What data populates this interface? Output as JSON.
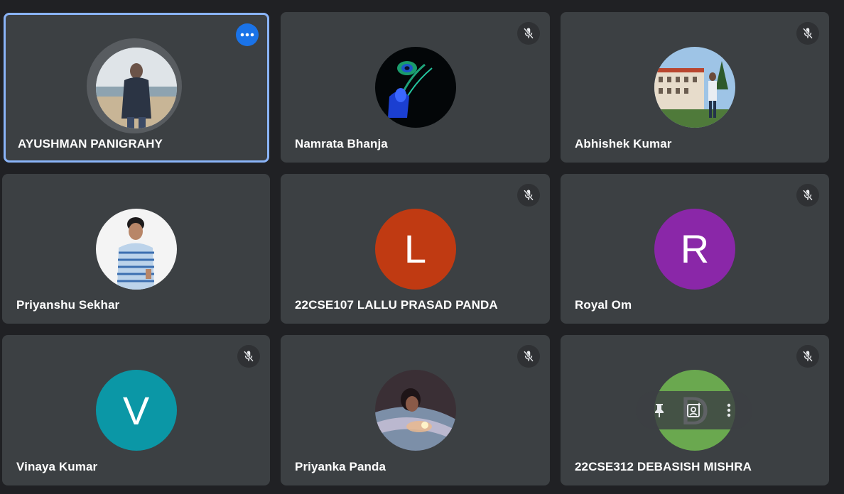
{
  "participants": [
    {
      "name": "AYUSHMAN PANIGRAHY",
      "avatar": "photo-beach-person-icon",
      "muted": false,
      "speaking": true
    },
    {
      "name": "Namrata Bhanja",
      "avatar": "photo-peacock-feather-icon",
      "muted": true
    },
    {
      "name": "Abhishek Kumar",
      "avatar": "photo-building-person-icon",
      "muted": true
    },
    {
      "name": "Priyanshu Sekhar",
      "avatar": "photo-person-striped-shirt-icon",
      "muted": false
    },
    {
      "name": "22CSE107 LALLU PRASAD PANDA",
      "initial": "L",
      "color": "#c03a12",
      "muted": true
    },
    {
      "name": "Royal Om",
      "initial": "R",
      "color": "#8a27a8",
      "muted": true
    },
    {
      "name": "Vinaya Kumar",
      "initial": "V",
      "color": "#0b97a6",
      "muted": true
    },
    {
      "name": "Priyanka Panda",
      "avatar": "photo-person-lights-icon",
      "muted": true
    },
    {
      "name": "22CSE312 DEBASISH MISHRA",
      "initial": "D",
      "color": "#6aa84f",
      "muted": true
    }
  ],
  "colors": {
    "background": "#202124",
    "tile": "#3c4043",
    "active_border": "#8ab4f8",
    "menu_button": "#1a73e8"
  },
  "icons": {
    "mute": "mic-off-icon",
    "more": "more-horiz-icon",
    "pin": "pin-icon",
    "frame": "add-photo-icon",
    "overflow": "more-vert-icon"
  }
}
